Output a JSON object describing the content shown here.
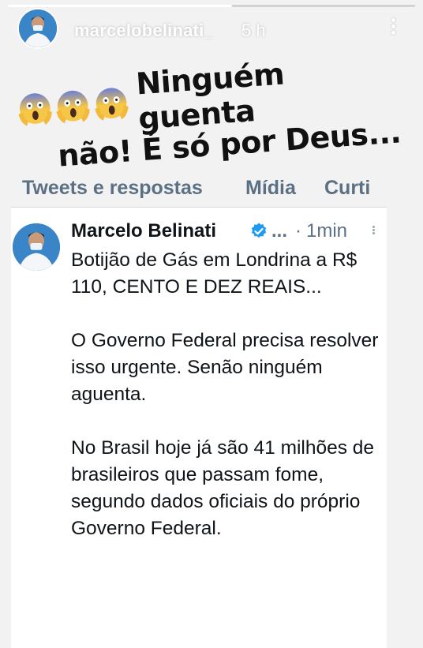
{
  "story": {
    "username": "marcelobelinati_",
    "time": "5 h",
    "progress": 0.55,
    "caption_line1": "Ninguém guenta",
    "caption_line2": "não! É só por Deus..."
  },
  "tabs": [
    {
      "label": "Tweets e respostas"
    },
    {
      "label": "Mídia"
    },
    {
      "label": "Curti"
    }
  ],
  "tweet": {
    "name": "Marcelo Belinati",
    "ellipsis": "...",
    "separator": "·",
    "time": "1min",
    "paragraphs": [
      "Botijão de Gás em Londrina a R$ 110, CENTO E DEZ REAIS...",
      "O Governo Federal precisa resolver isso urgente. Senão ninguém aguenta.",
      "No Brasil hoje já são 41 milhões de brasileiros que passam fome, segundo dados oficiais do próprio Governo Federal."
    ]
  },
  "colors": {
    "verified": "#1d9bf0",
    "muted": "#5b7083",
    "avatar_bg": "#3a84c8"
  },
  "icons": [
    "scream-emoji",
    "verified-badge-icon",
    "more-options-icon"
  ]
}
